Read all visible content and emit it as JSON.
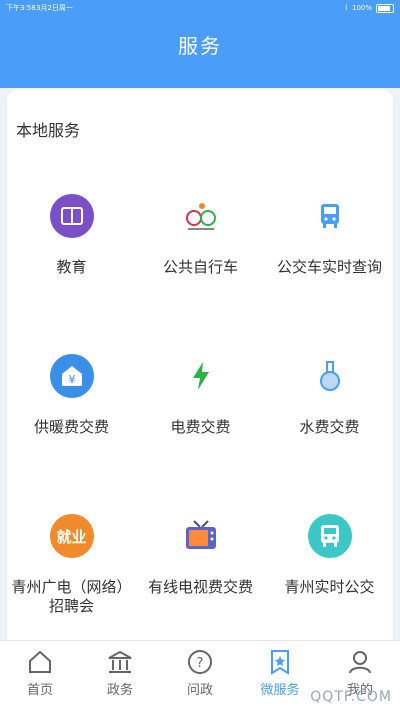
{
  "status_bar": {
    "time": "下午3:58",
    "date": "3月2日周一",
    "battery": "100%"
  },
  "header": {
    "title": "服务"
  },
  "section": {
    "title": "本地服务"
  },
  "services": [
    {
      "label": "教育",
      "icon": "book-icon",
      "color": "#7a4fc7"
    },
    {
      "label": "公共自行车",
      "icon": "bicycle-logo-icon",
      "color": "#d3344b"
    },
    {
      "label": "公交车实时查询",
      "icon": "bus-icon",
      "color": "#4a9df8"
    },
    {
      "label": "供暖费交费",
      "icon": "heating-yuan-icon",
      "color": "#3a8fe8"
    },
    {
      "label": "电费交费",
      "icon": "lightning-icon",
      "color": "#2bb34a"
    },
    {
      "label": "水费交费",
      "icon": "flask-icon",
      "color": "#4a9df8"
    },
    {
      "label": "青州广电（网络）招聘会",
      "icon": "jobs-icon",
      "badge": "就业",
      "color": "#f08a2a"
    },
    {
      "label": "有线电视费交费",
      "icon": "tv-icon",
      "color": "#5766c8"
    },
    {
      "label": "青州实时公交",
      "icon": "realtime-bus-icon",
      "color": "#3bc7c6"
    }
  ],
  "tabs": [
    {
      "label": "首页",
      "icon": "home-icon",
      "active": false
    },
    {
      "label": "政务",
      "icon": "government-icon",
      "active": false
    },
    {
      "label": "问政",
      "icon": "question-icon",
      "active": false
    },
    {
      "label": "微服务",
      "icon": "bookmark-star-icon",
      "active": true
    },
    {
      "label": "我的",
      "icon": "user-icon",
      "active": false
    }
  ],
  "watermark": "QQTF.COM"
}
